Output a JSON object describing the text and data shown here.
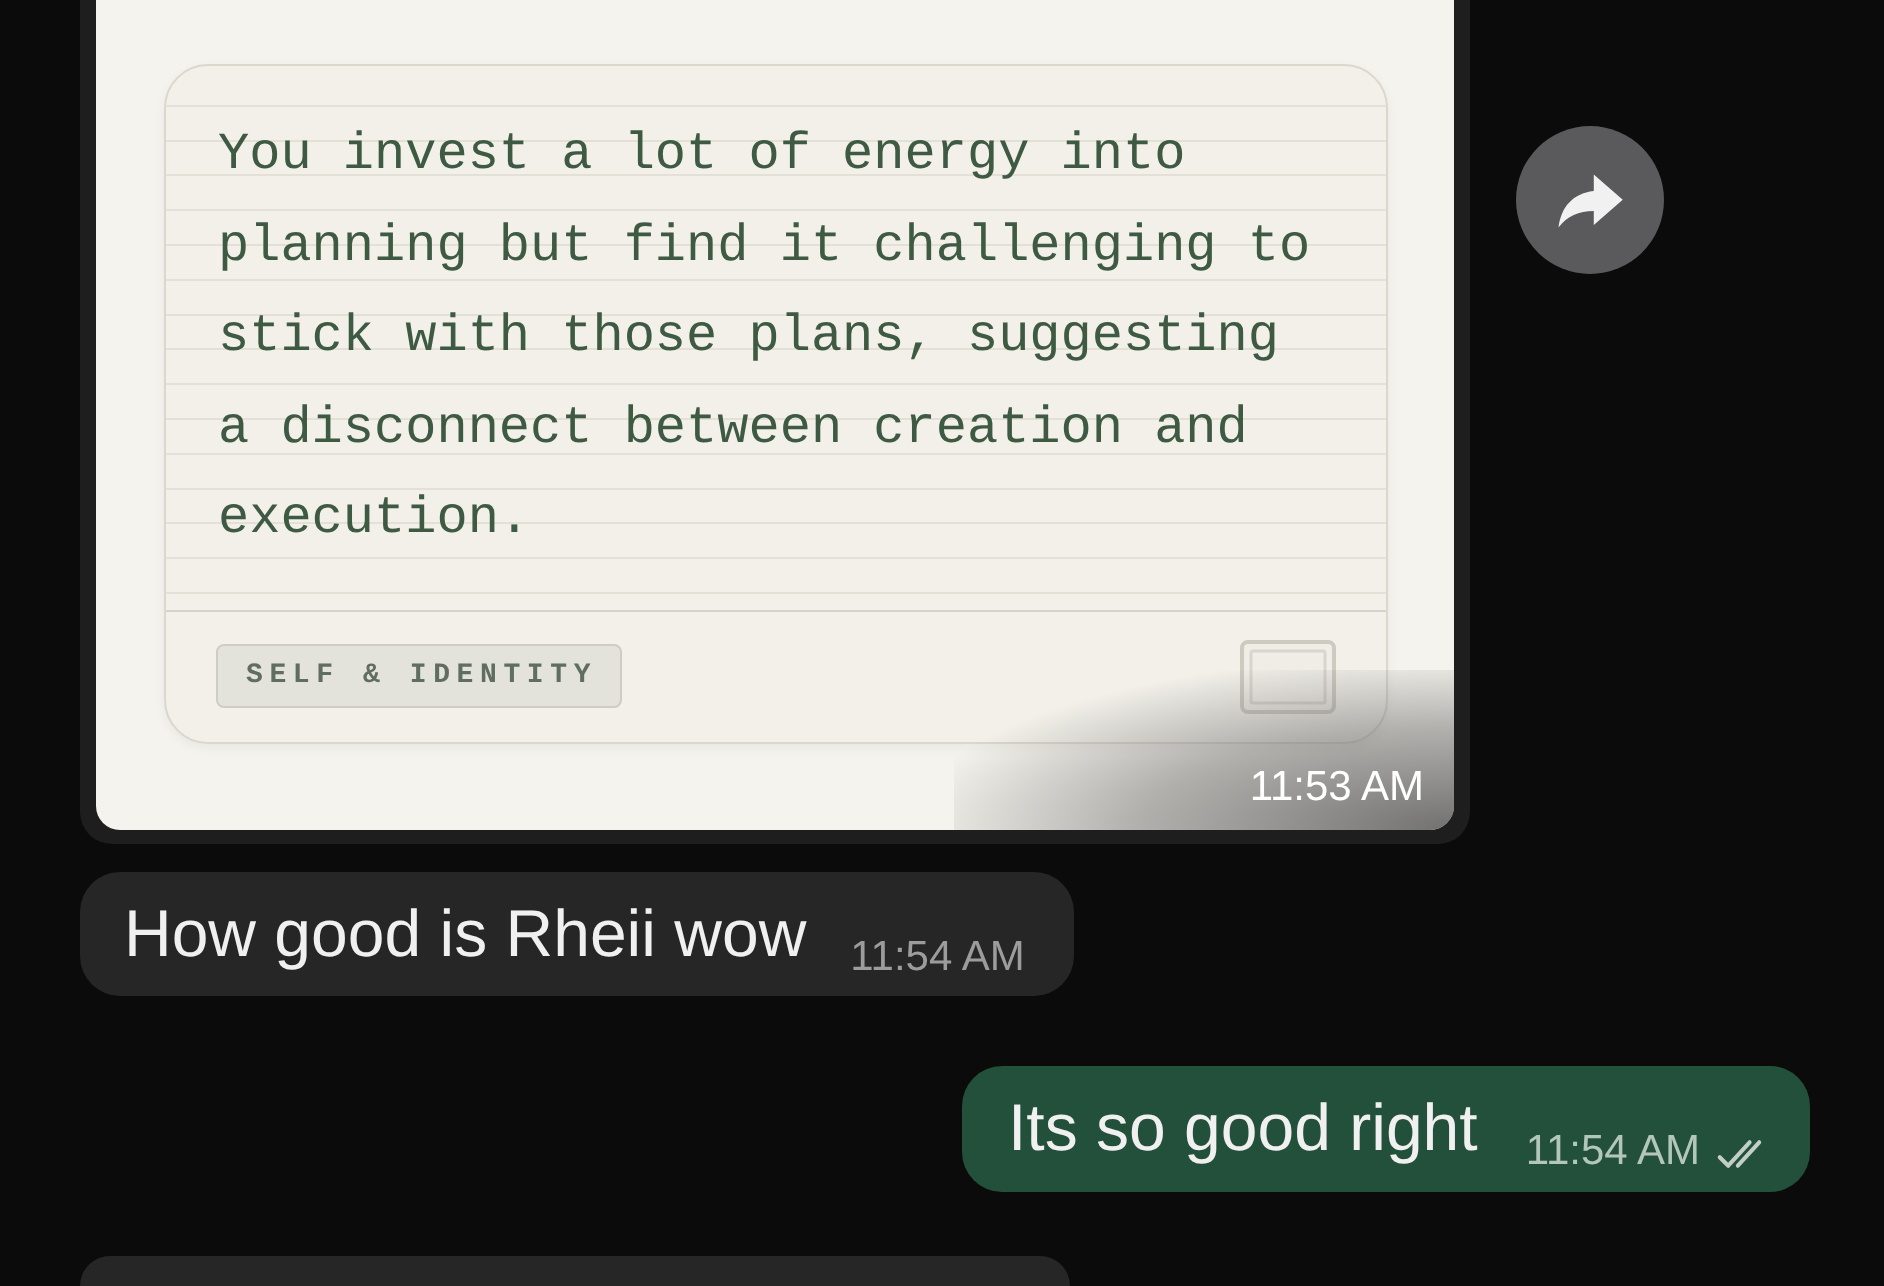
{
  "chat": {
    "messages": [
      {
        "kind": "image",
        "from_me": false,
        "card": {
          "text": "You invest a lot of energy into planning but find it challenging to stick with those plans, suggesting a disconnect between creation and execution.",
          "tag": "SELF & IDENTITY"
        },
        "time": "11:53 AM",
        "forward_button": true
      },
      {
        "kind": "text",
        "from_me": false,
        "text": "How good is Rheii wow",
        "time": "11:54 AM"
      },
      {
        "kind": "text",
        "from_me": true,
        "text": "Its so good right",
        "time": "11:54 AM",
        "delivered": true,
        "read": false
      },
      {
        "kind": "partial",
        "from_me": false
      }
    ]
  }
}
